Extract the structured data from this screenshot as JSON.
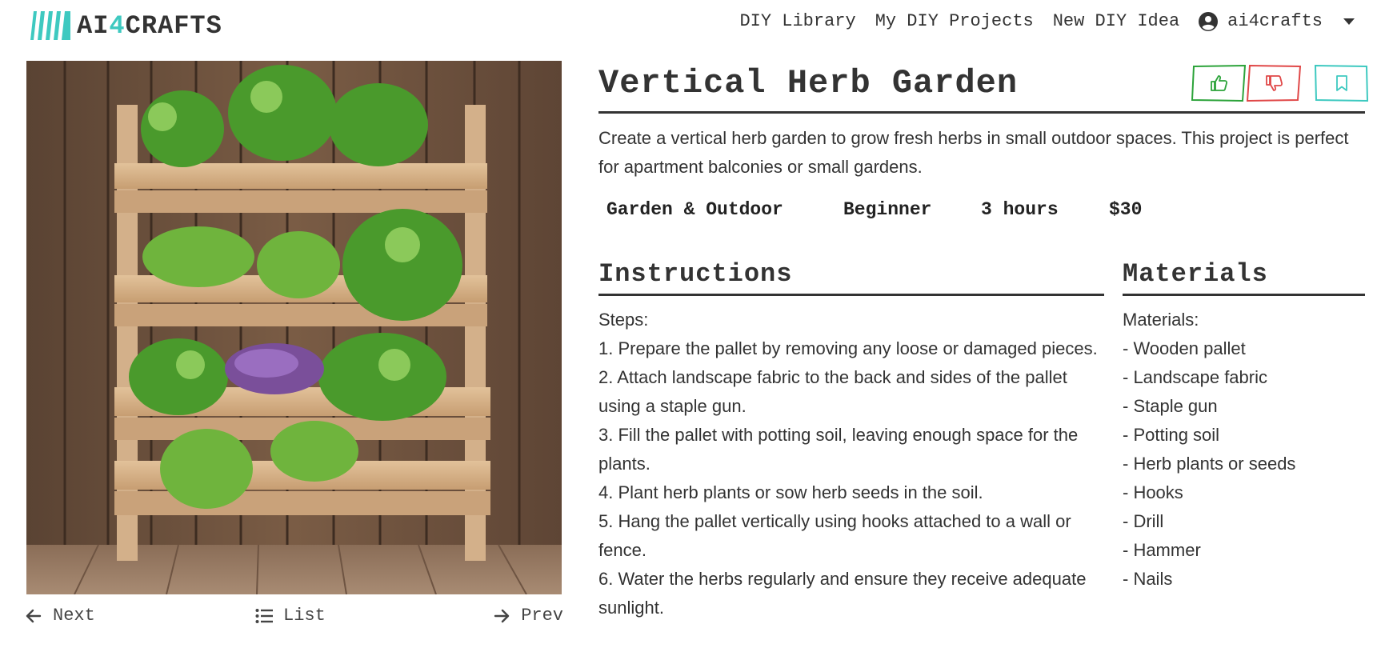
{
  "header": {
    "logo_prefix": "AI",
    "logo_accent": "4",
    "logo_suffix": "CRAFTS",
    "nav": [
      "DIY Library",
      "My DIY Projects",
      "New DIY Idea"
    ],
    "username": "ai4crafts"
  },
  "pager": {
    "next_label": "Next",
    "list_label": "List",
    "prev_label": "Prev"
  },
  "project": {
    "title": "Vertical Herb Garden",
    "description": "Create a vertical herb garden to grow fresh herbs in small outdoor spaces. This project is perfect for apartment balconies or small gardens.",
    "tags": [
      "Garden & Outdoor",
      "Beginner",
      "3 hours",
      "$30"
    ]
  },
  "instructions": {
    "heading": "Instructions",
    "intro": "Steps:",
    "steps": [
      "1. Prepare the pallet by removing any loose or damaged pieces.",
      "2. Attach landscape fabric to the back and sides of the pallet using a staple gun.",
      "3. Fill the pallet with potting soil, leaving enough space for the plants.",
      "4. Plant herb plants or sow herb seeds in the soil.",
      "5. Hang the pallet vertically using hooks attached to a wall or fence.",
      "6. Water the herbs regularly and ensure they receive adequate sunlight."
    ]
  },
  "materials": {
    "heading": "Materials",
    "intro": "Materials:",
    "items": [
      "- Wooden pallet",
      "- Landscape fabric",
      "- Staple gun",
      "- Potting soil",
      "- Herb plants or seeds",
      "- Hooks",
      "- Drill",
      "- Hammer",
      "- Nails"
    ]
  },
  "colors": {
    "accent": "#3ec9c0",
    "like": "#2ca33a",
    "dislike": "#e04848",
    "save": "#3ec9c0",
    "tag_bg": "#d6d6d6",
    "text": "#333333"
  },
  "icons": {
    "logo": "stripes-logo-icon",
    "user": "user-circle-icon",
    "caret": "caret-down-icon",
    "next": "arrow-left-icon",
    "list": "list-icon",
    "prev": "arrow-right-icon",
    "like": "thumbs-up-icon",
    "dislike": "thumbs-down-icon",
    "save": "bookmark-icon"
  }
}
